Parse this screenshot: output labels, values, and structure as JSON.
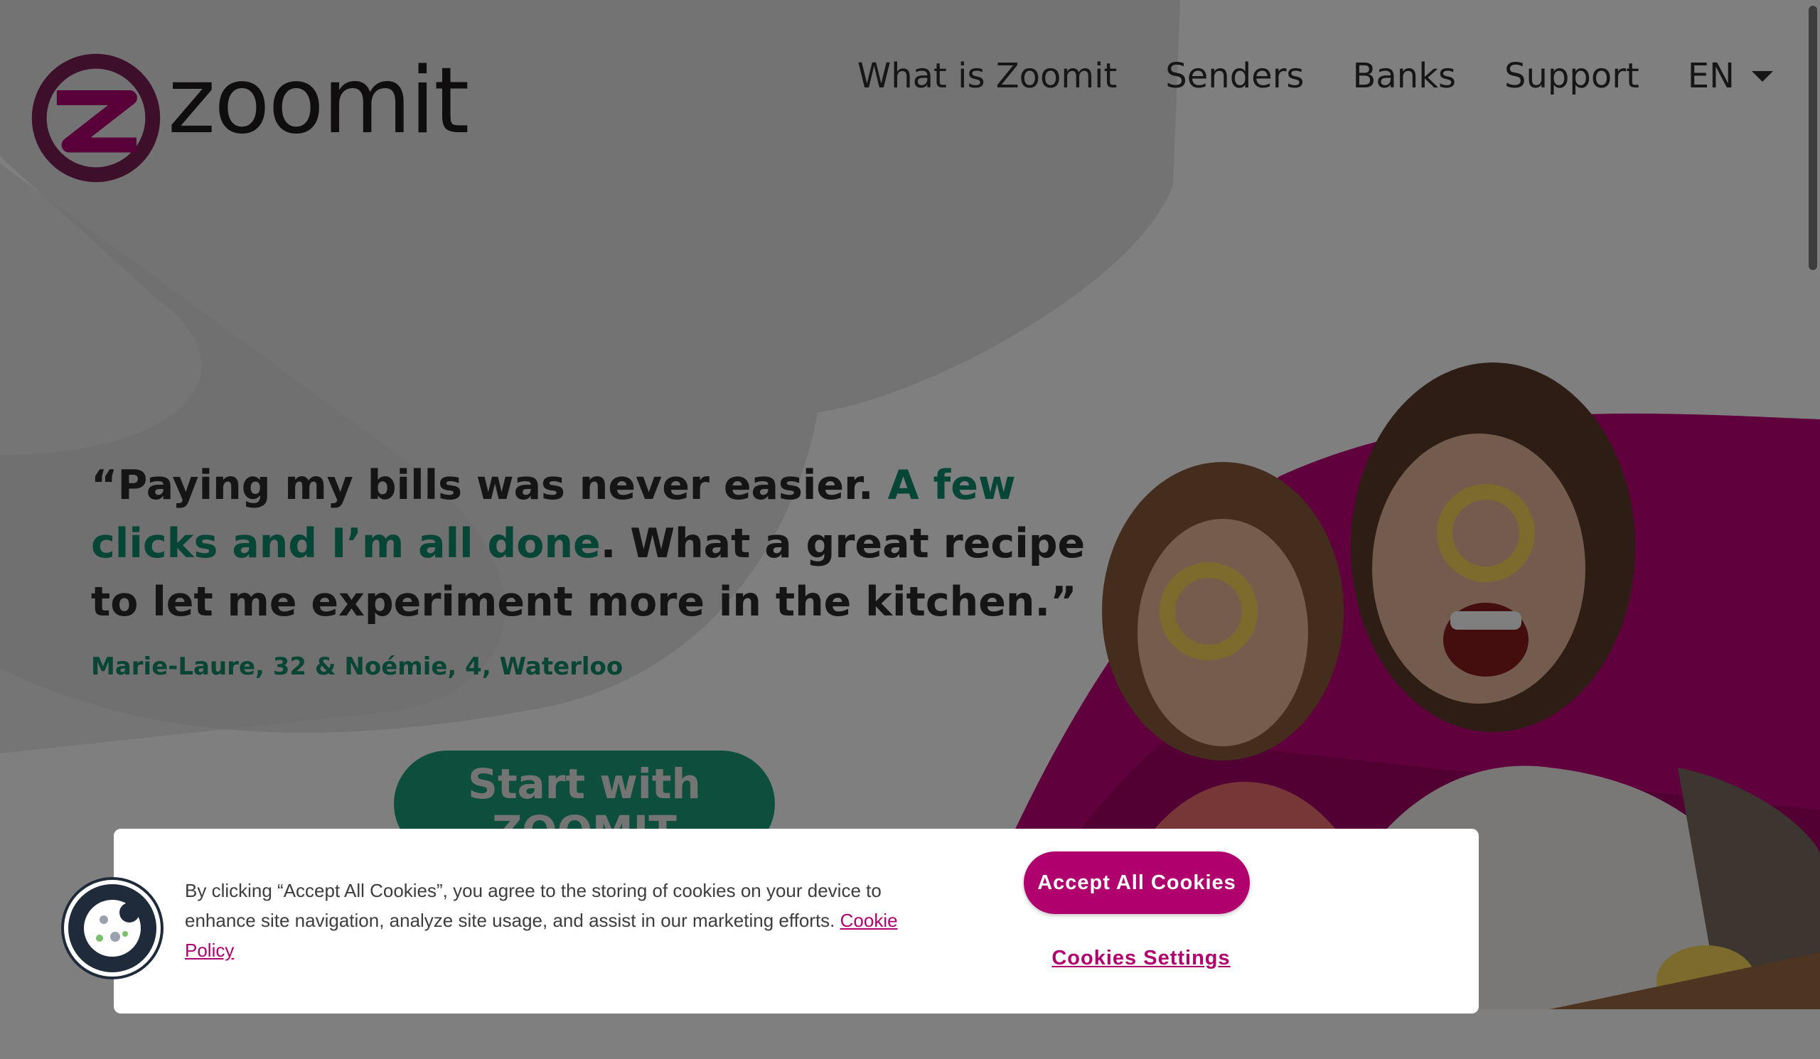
{
  "brand": {
    "name": "zoomit",
    "accent": "#b0006e",
    "green": "#0f8c6c"
  },
  "nav": {
    "items": [
      "What is Zoomit",
      "Senders",
      "Banks",
      "Support"
    ],
    "language": "EN"
  },
  "hero": {
    "quote_part1": "“Paying my bills was never easier. ",
    "quote_highlight": "A few clicks and I’m all done",
    "quote_part2": ". What a great recipe to let me experiment more in the kitchen.”",
    "author": "Marie-Laure, 32 & Noémie, 4, Waterloo",
    "cta_label": "Start with ZOOMIT"
  },
  "cookies": {
    "text": "By clicking “Accept All Cookies”, you agree to the storing of cookies on your device to enhance site navigation, analyze site usage, and assist in our marketing efforts. ",
    "policy_link": "Cookie Policy",
    "accept_label": "Accept All Cookies",
    "settings_label": "Cookies Settings"
  },
  "icons": {
    "logo": "zoomit-logo-icon",
    "caret": "caret-down-icon",
    "cookie": "cookie-icon"
  }
}
